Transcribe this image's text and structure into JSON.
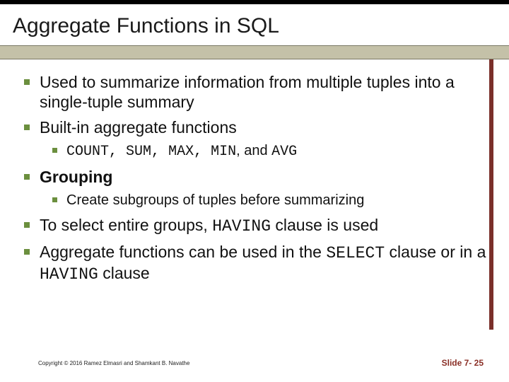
{
  "title": "Aggregate Functions in SQL",
  "bullets": {
    "b1": "Used to summarize information from multiple tuples into a single-tuple summary",
    "b2": "Built-in aggregate functions",
    "b2_sub_prefix": "COUNT",
    "b2_sub_sep1": ", ",
    "b2_sub_sum": "SUM",
    "b2_sub_sep2": ", ",
    "b2_sub_max": "MAX",
    "b2_sub_sep3": ", ",
    "b2_sub_min": "MIN",
    "b2_sub_sep4": ", ",
    "b2_sub_and": "and ",
    "b2_sub_avg": "AVG",
    "b3": "Grouping",
    "b3_sub": "Create subgroups of tuples before summarizing",
    "b4_pre": "To select entire groups, ",
    "b4_code": "HAVING",
    "b4_post": " clause is used",
    "b5_pre": "Aggregate functions can be used in the ",
    "b5_code1": "SELECT",
    "b5_mid": " clause or in a ",
    "b5_code2": "HAVING",
    "b5_post": " clause"
  },
  "footer": {
    "copyright": "Copyright © 2016 Ramez Elmasri and Shamkant B. Navathe",
    "slide": "Slide 7- 25"
  }
}
